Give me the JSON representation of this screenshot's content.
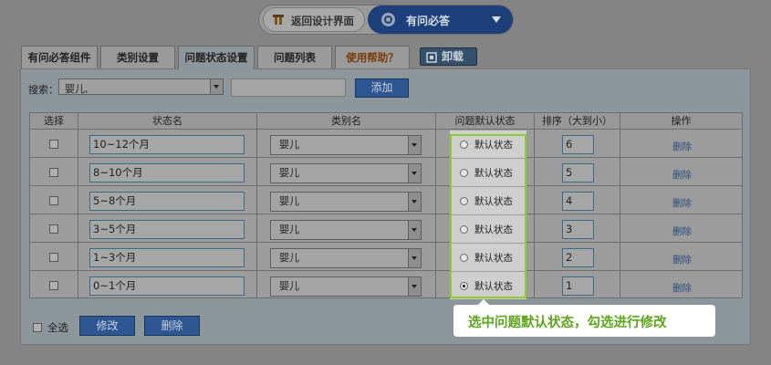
{
  "topbar": {
    "back_label": "返回设计界面",
    "mode_label": "有问必答"
  },
  "tabs": [
    {
      "label": "有问必答组件"
    },
    {
      "label": "类别设置"
    },
    {
      "label": "问题状态设置"
    },
    {
      "label": "问题列表"
    },
    {
      "label": "使用帮助？"
    }
  ],
  "unload_label": "卸载",
  "search": {
    "label": "搜索：",
    "selected": "婴儿,",
    "input_value": "",
    "add_label": "添加"
  },
  "table": {
    "headers": {
      "select": "选择",
      "name": "状态名",
      "category": "类别名",
      "default": "问题默认状态",
      "sort": "排序（大到小）",
      "action": "操作"
    },
    "rows": [
      {
        "name": "10~12个月",
        "category": "婴儿",
        "default_label": "默认状态",
        "sort": "6",
        "action": "删除"
      },
      {
        "name": "8~10个月",
        "category": "婴儿",
        "default_label": "默认状态",
        "sort": "5",
        "action": "删除"
      },
      {
        "name": "5~8个月",
        "category": "婴儿",
        "default_label": "默认状态",
        "sort": "4",
        "action": "删除"
      },
      {
        "name": "3~5个月",
        "category": "婴儿",
        "default_label": "默认状态",
        "sort": "3",
        "action": "删除"
      },
      {
        "name": "1~3个月",
        "category": "婴儿",
        "default_label": "默认状态",
        "sort": "2",
        "action": "删除"
      },
      {
        "name": "0~1个月",
        "category": "婴儿",
        "default_label": "默认状态",
        "sort": "1",
        "action": "删除"
      }
    ],
    "selected_default_row": 5
  },
  "footer": {
    "select_all": "全选",
    "modify": "修改",
    "delete": "删除"
  },
  "callout": {
    "text": "选中问题默认状态，勾选进行修改"
  },
  "colors": {
    "highlight": "#8ccc2b",
    "callout_text": "#5da51c",
    "primary_button": "#2e5691"
  }
}
